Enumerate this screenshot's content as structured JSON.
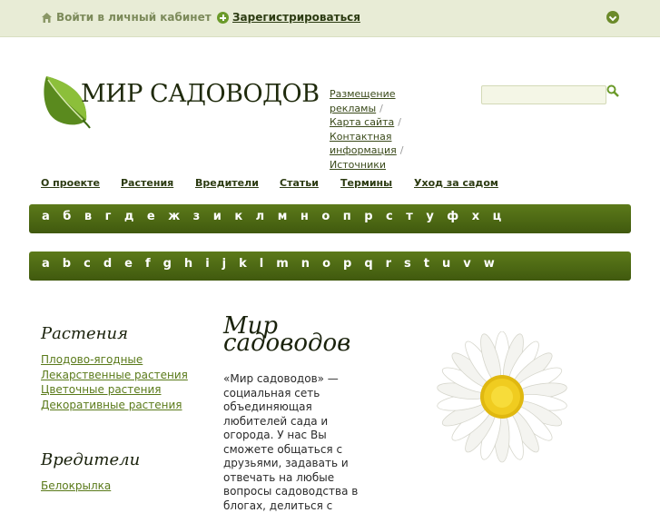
{
  "topbar": {
    "login": "Войти в личный кабинет",
    "register": "Зарегистрироваться"
  },
  "logo": {
    "title": "МИР САДОВОДОВ"
  },
  "toplinks": [
    {
      "label": "Размещение рекламы"
    },
    {
      "label": "Карта сайта"
    },
    {
      "label": "Контактная информация"
    },
    {
      "label": "Источники"
    }
  ],
  "search": {
    "placeholder": ""
  },
  "nav": [
    {
      "label": "О проекте"
    },
    {
      "label": "Растения"
    },
    {
      "label": "Вредители"
    },
    {
      "label": "Статьи"
    },
    {
      "label": "Термины"
    },
    {
      "label": "Уход за садом"
    }
  ],
  "alphabet_ru": [
    "а",
    "б",
    "в",
    "г",
    "д",
    "е",
    "ж",
    "з",
    "и",
    "к",
    "л",
    "м",
    "н",
    "о",
    "п",
    "р",
    "с",
    "т",
    "у",
    "ф",
    "х",
    "ц"
  ],
  "alphabet_en": [
    "a",
    "b",
    "c",
    "d",
    "e",
    "f",
    "g",
    "h",
    "i",
    "j",
    "k",
    "l",
    "m",
    "n",
    "o",
    "p",
    "q",
    "r",
    "s",
    "t",
    "u",
    "v",
    "w"
  ],
  "sidebar": {
    "plants_title": "Растения",
    "plants": [
      {
        "label": "Плодово-ягодные"
      },
      {
        "label": "Лекарственные растения"
      },
      {
        "label": "Цветочные растения"
      },
      {
        "label": "Декоративные растения"
      }
    ],
    "pests_title": "Вредители",
    "pests": [
      {
        "label": "Белокрылка"
      }
    ]
  },
  "content": {
    "title_line1": "Мир",
    "title_line2": "садоводов",
    "text": "«Мир садоводов» — социальная сеть объединяющая любителей сада и огорода. У нас Вы сможете общаться с друзьями, задавать и отвечать на любые вопросы садоводства в блогах, делиться с"
  },
  "colors": {
    "accent": "#4e6b14",
    "topbar_bg": "#e8ecd6",
    "link": "#5a7a1a"
  }
}
